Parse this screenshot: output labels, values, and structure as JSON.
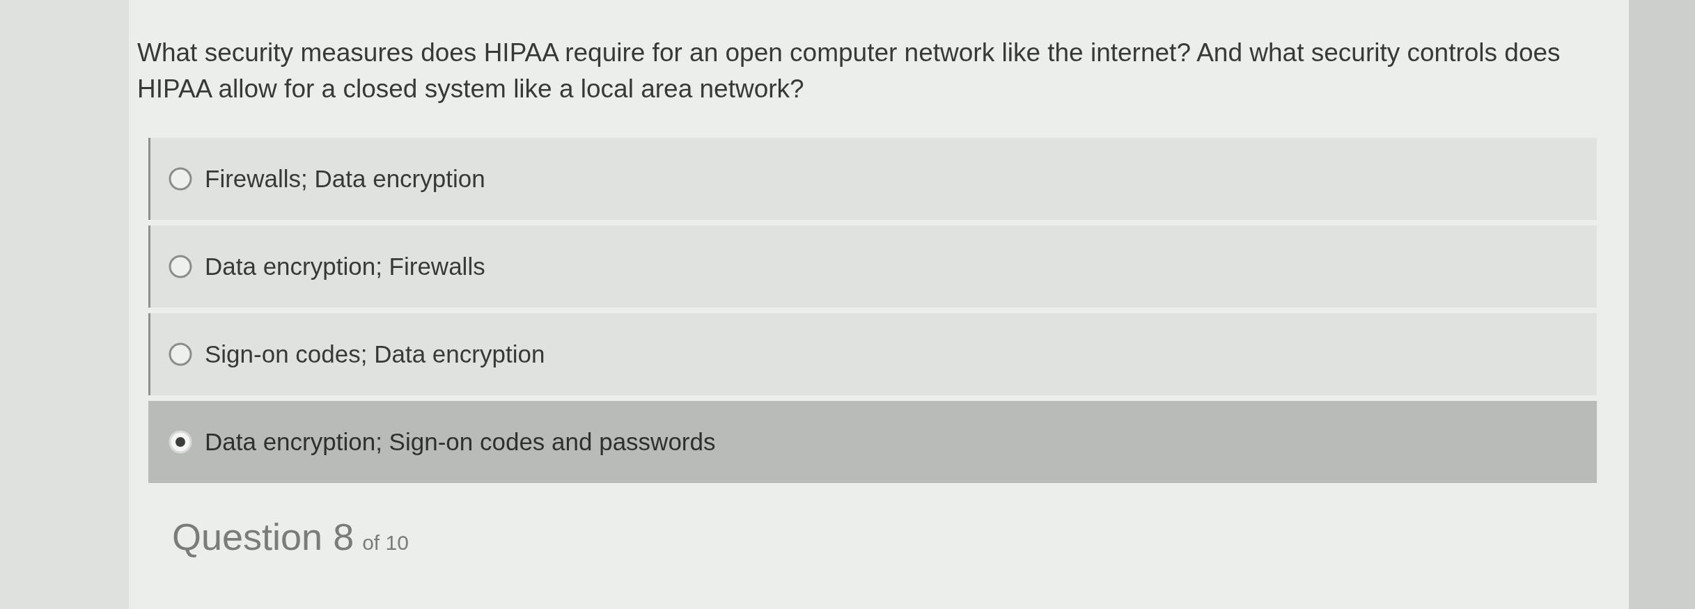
{
  "question": {
    "text": "What security measures does HIPAA require for an open computer network like the internet? And what security controls does HIPAA allow for a closed system like a local area network?"
  },
  "options": [
    {
      "label": "Firewalls; Data encryption",
      "selected": false
    },
    {
      "label": "Data encryption; Firewalls",
      "selected": false
    },
    {
      "label": "Sign-on codes; Data encryption",
      "selected": false
    },
    {
      "label": "Data encryption; Sign-on codes and passwords",
      "selected": true
    }
  ],
  "footer": {
    "question_label": "Question 8",
    "count": "of 10"
  }
}
